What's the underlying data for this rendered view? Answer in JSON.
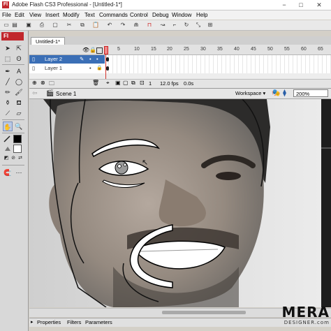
{
  "window": {
    "title": "Adobe Flash CS3 Professional - [Untitled-1*]",
    "app_badge": "Fl",
    "min_glyph": "−",
    "max_glyph": "□",
    "close_glyph": "✕"
  },
  "menu": [
    "File",
    "Edit",
    "View",
    "Insert",
    "Modify",
    "Text",
    "Commands",
    "Control",
    "Debug",
    "Window",
    "Help"
  ],
  "document": {
    "tab": "Untitled-1*"
  },
  "timeline": {
    "frame_numbers": [
      "5",
      "10",
      "15",
      "20",
      "25",
      "30",
      "35",
      "40",
      "45",
      "50",
      "55",
      "60",
      "65"
    ],
    "layers": [
      {
        "name": "Layer 2",
        "selected": true
      },
      {
        "name": "Layer 1",
        "selected": false
      }
    ],
    "current_frame": "1",
    "fps": "12.0 fps",
    "elapsed": "0.0s"
  },
  "editbar": {
    "scene": "Scene 1",
    "workspace": "Workspace",
    "zoom": "200%"
  },
  "panels": {
    "tabs": [
      "Properties",
      "Filters",
      "Parameters"
    ]
  },
  "watermark": {
    "line1": "MERA",
    "line2": "DESIGNER.com"
  },
  "colors": {
    "accent": "#c1272d",
    "layer_selected": "#3b6fb6",
    "stroke": "#000000",
    "fill": "#ffffff"
  },
  "icons": [
    "arrow-icon",
    "subselect-icon",
    "free-transform-icon",
    "lasso-icon",
    "pen-icon",
    "text-icon",
    "line-icon",
    "rect-icon",
    "pencil-icon",
    "brush-icon",
    "ink-bottle-icon",
    "paint-bucket-icon",
    "eyedropper-icon",
    "eraser-icon",
    "hand-icon",
    "zoom-icon"
  ]
}
